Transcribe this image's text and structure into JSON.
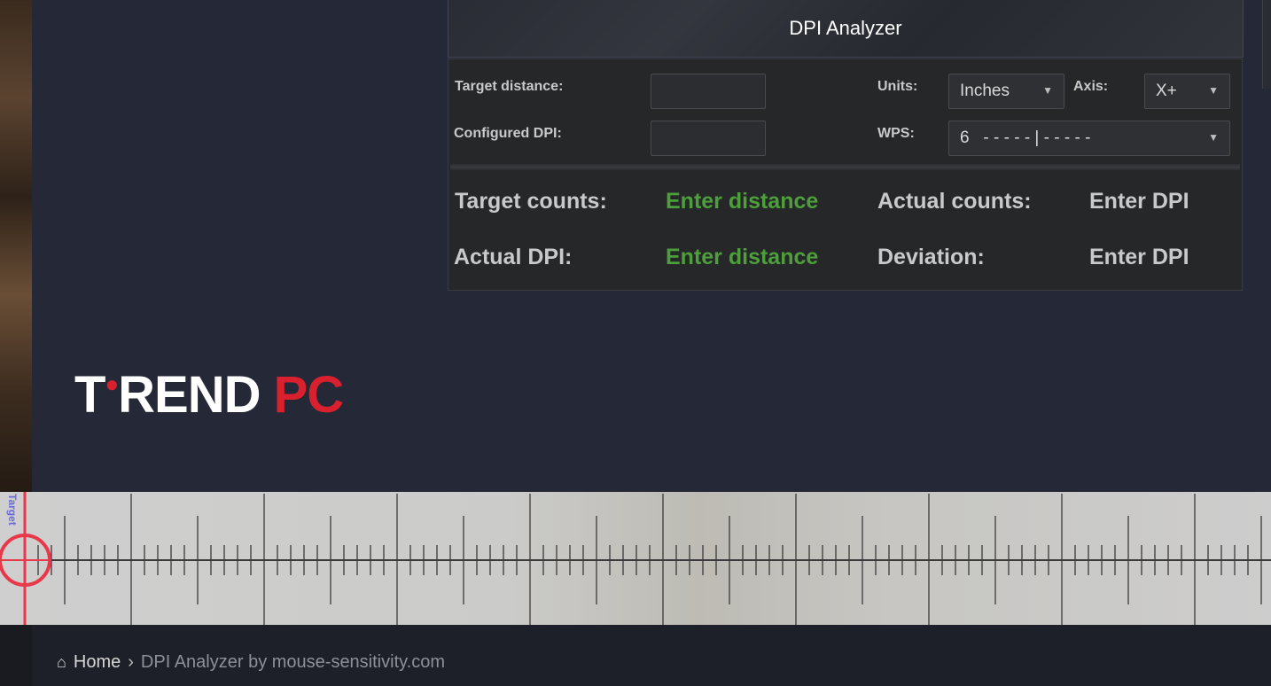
{
  "panel": {
    "title": "DPI Analyzer",
    "target_distance_label": "Target distance:",
    "configured_dpi_label": "Configured DPI:",
    "target_distance_value": "",
    "configured_dpi_value": "",
    "units_label": "Units:",
    "units_value": "Inches",
    "axis_label": "Axis:",
    "axis_value": "X+",
    "wps_label": "WPS:",
    "wps_value": "6   - - - - - | - - - - -"
  },
  "results": {
    "target_counts_label": "Target counts:",
    "target_counts_value": "Enter distance",
    "actual_counts_label": "Actual counts:",
    "actual_counts_value": "Enter DPI",
    "actual_dpi_label": "Actual DPI:",
    "actual_dpi_value": "Enter distance",
    "deviation_label": "Deviation:",
    "deviation_value": "Enter DPI"
  },
  "logo": {
    "part1": "T",
    "part2": "REND ",
    "part3": "PC"
  },
  "ruler": {
    "target_label": "Target"
  },
  "breadcrumb": {
    "home_label": "Home",
    "current_label": "DPI Analyzer by mouse-sensitivity.com"
  },
  "colors": {
    "accent_green": "#4c9f3a",
    "brand_red": "#d8202e",
    "target_red": "#e8384a"
  }
}
